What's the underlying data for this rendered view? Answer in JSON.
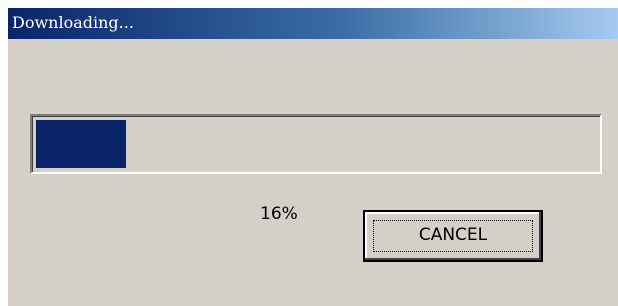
{
  "window": {
    "title": "Downloading...",
    "title_bar_colors": [
      "#0a246a",
      "#a6caf0"
    ]
  },
  "progress": {
    "fraction": 0.16,
    "fill_color": "#0a246a",
    "percent_label": "16%"
  },
  "buttons": {
    "cancel_label": "CANCEL"
  }
}
